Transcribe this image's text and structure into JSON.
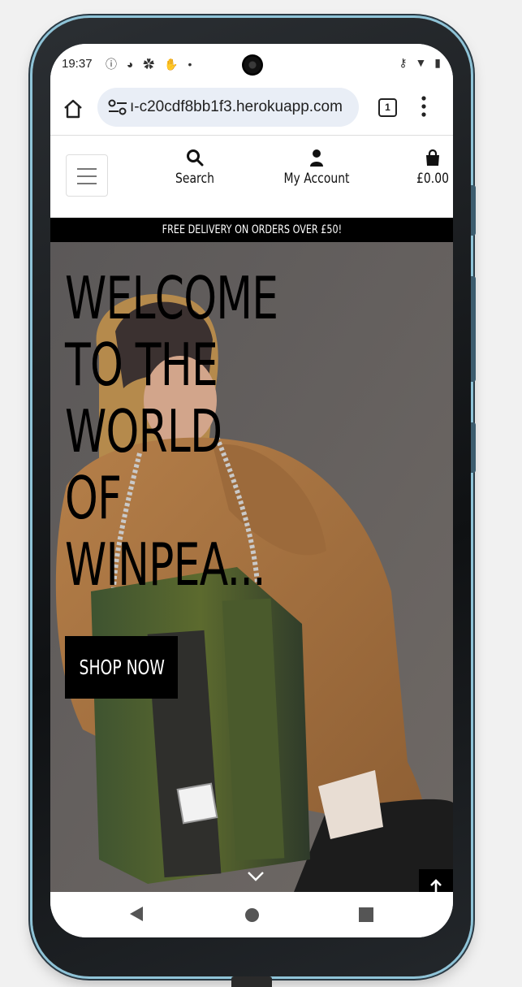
{
  "status_bar": {
    "time": "19:37",
    "left_icons": "ⓘ ◕ ✿ ✋ •",
    "right_icons": "⚷ ▼ ▮"
  },
  "browser": {
    "url": "ı-c20cdf8bb1f3.herokuapp.com",
    "tab_count": "1"
  },
  "header": {
    "nav": [
      {
        "label": "Search",
        "icon": "search-icon"
      },
      {
        "label": "My Account",
        "icon": "user-icon"
      },
      {
        "label": "£0.00",
        "icon": "shopping-bag-icon"
      }
    ]
  },
  "banner": {
    "text": "FREE DELIVERY ON ORDERS OVER £50!"
  },
  "hero": {
    "title_lines": [
      "WELCOME",
      "TO THE",
      "WORLD",
      "OF",
      "WINPEA..."
    ],
    "cta_label": "SHOP NOW"
  },
  "colors": {
    "banner_bg": "#000000",
    "hero_bg": "#67625f",
    "jacket": "#a4713f",
    "screen_bg": "#ffffff",
    "phone_frame_accent": "#8fc4d8"
  }
}
